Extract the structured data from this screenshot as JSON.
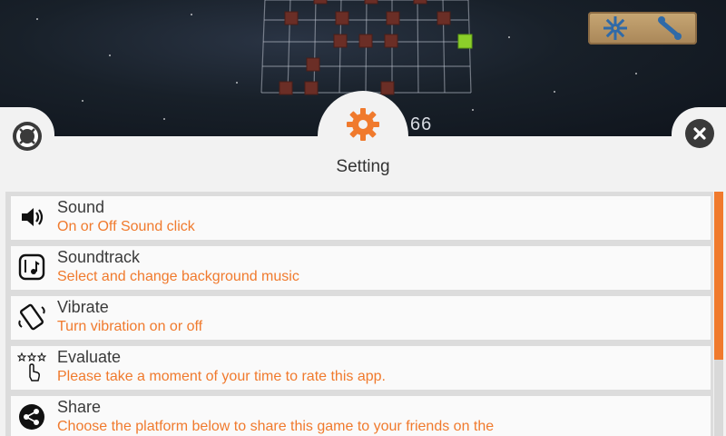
{
  "game": {
    "score": "66"
  },
  "header": {
    "title": "Setting",
    "icons": {
      "left": "lifebuoy-icon",
      "right": "close-icon",
      "center": "gear-icon"
    },
    "accent": "#f07a2d"
  },
  "tools": {
    "icons": [
      "gear-tool-icon",
      "wrench-tool-icon"
    ]
  },
  "settings": {
    "items": [
      {
        "title": "Sound",
        "subtitle": "On or Off Sound click",
        "icon": "speaker-icon"
      },
      {
        "title": "Soundtrack",
        "subtitle": "Select and change background music",
        "icon": "music-note-icon"
      },
      {
        "title": "Vibrate",
        "subtitle": "Turn vibration on or off",
        "icon": "phone-vibrate-icon"
      },
      {
        "title": "Evaluate",
        "subtitle": "Please take a moment of your time to rate this app.",
        "icon": "rate-stars-icon"
      },
      {
        "title": "Share",
        "subtitle": "Choose the platform below to share this game to your friends on the",
        "icon": "share-icon"
      }
    ]
  }
}
